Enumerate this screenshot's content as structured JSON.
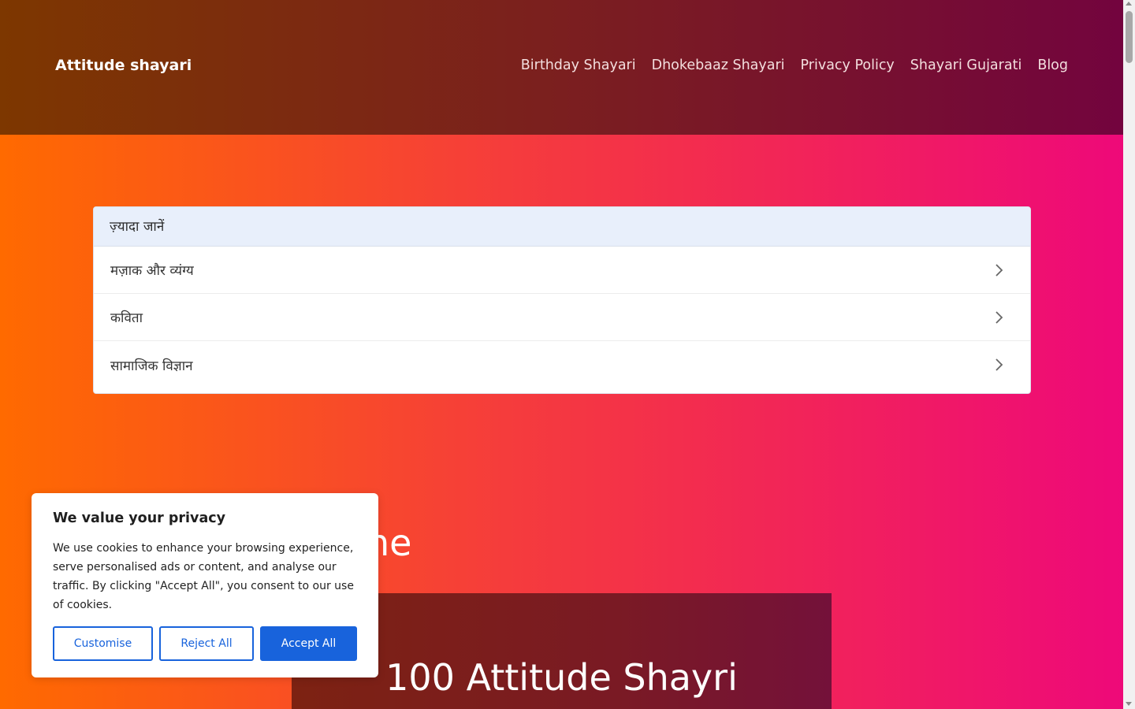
{
  "header": {
    "site_title": "Attitude shayari",
    "nav": [
      {
        "label": "Birthday Shayari"
      },
      {
        "label": "Dhokebaaz Shayari"
      },
      {
        "label": "Privacy Policy"
      },
      {
        "label": "Shayari Gujarati"
      },
      {
        "label": "Blog"
      }
    ]
  },
  "learn_more": {
    "title": "ज़्यादा जानें",
    "items": [
      {
        "label": "मज़ाक और व्यंग्य",
        "icon": "chevron-right-icon"
      },
      {
        "label": "कविता",
        "icon": "chevron-right-icon"
      },
      {
        "label": "सामाजिक विज्ञान",
        "icon": "chevron-right-icon"
      }
    ]
  },
  "main": {
    "heading_partial": "ne",
    "hero_title": "100 Attitude Shayri"
  },
  "cookie": {
    "title": "We value your privacy",
    "text": "We use cookies to enhance your browsing experience, serve personalised ads or content, and analyse our traffic. By clicking \"Accept All\", you consent to our use of cookies.",
    "customise_label": "Customise",
    "reject_label": "Reject All",
    "accept_label": "Accept All",
    "accent_color": "#1863dc"
  }
}
